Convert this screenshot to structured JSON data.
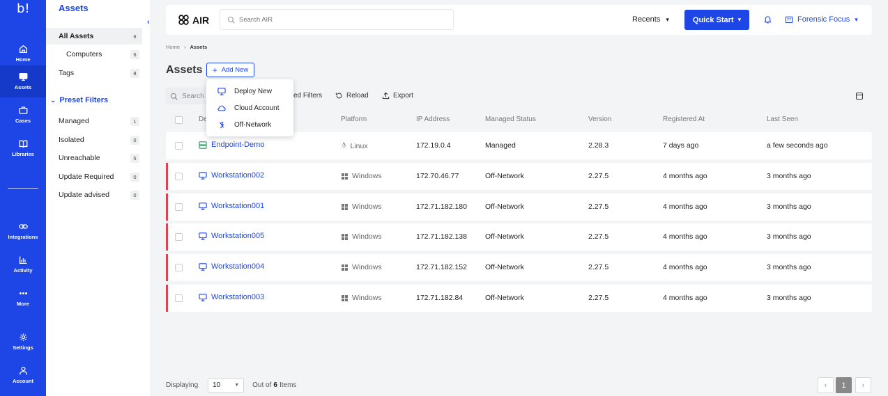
{
  "brand": {
    "logo": "b!",
    "product": "AIR"
  },
  "leftnav": [
    {
      "label": "Home",
      "icon": "home-icon"
    },
    {
      "label": "Assets",
      "icon": "monitor-icon"
    },
    {
      "label": "Cases",
      "icon": "briefcase-icon"
    },
    {
      "label": "Libraries",
      "icon": "book-icon"
    },
    {
      "label": "Integrations",
      "icon": "link-icon"
    },
    {
      "label": "Activity",
      "icon": "chart-icon"
    },
    {
      "label": "More",
      "icon": "dots-icon"
    },
    {
      "label": "Settings",
      "icon": "gear-icon"
    },
    {
      "label": "Account",
      "icon": "user-icon"
    }
  ],
  "sidebar": {
    "title": "Assets",
    "collapse": "‹",
    "items": [
      {
        "label": "All Assets",
        "count": "6"
      },
      {
        "label": "Computers",
        "count": "6"
      },
      {
        "label": "Tags",
        "count": "8"
      }
    ],
    "preset_title": "Preset Filters",
    "presets": [
      {
        "label": "Managed",
        "count": "1"
      },
      {
        "label": "Isolated",
        "count": "0"
      },
      {
        "label": "Unreachable",
        "count": "5"
      },
      {
        "label": "Update Required",
        "count": "0"
      },
      {
        "label": "Update advised",
        "count": "0"
      }
    ]
  },
  "topbar": {
    "search_placeholder": "Search AIR",
    "recents": "Recents",
    "quick_start": "Quick Start",
    "org": "Forensic Focus"
  },
  "breadcrumb": {
    "home": "Home",
    "current": "Assets"
  },
  "page": {
    "title": "Assets",
    "add_new": "Add New"
  },
  "dropdown": [
    {
      "label": "Deploy New",
      "icon": "monitor-icon"
    },
    {
      "label": "Cloud Account",
      "icon": "cloud-icon"
    },
    {
      "label": "Off-Network",
      "icon": "off-network-icon"
    }
  ],
  "toolbar": {
    "search": "Search i",
    "filters": "ed Filters",
    "reload": "Reload",
    "export": "Export"
  },
  "table": {
    "headers": [
      "De",
      "Platform",
      "IP Address",
      "Managed Status",
      "Version",
      "Registered At",
      "Last Seen"
    ],
    "rows": [
      {
        "name": "Endpoint-Demo",
        "platform": "Linux",
        "ip": "172.19.0.4",
        "status": "Managed",
        "version": "2.28.3",
        "registered": "7 days ago",
        "last_seen": "a few seconds ago"
      },
      {
        "name": "Workstation002",
        "platform": "Windows",
        "ip": "172.70.46.77",
        "status": "Off-Network",
        "version": "2.27.5",
        "registered": "4 months ago",
        "last_seen": "3 months ago"
      },
      {
        "name": "Workstation001",
        "platform": "Windows",
        "ip": "172.71.182.180",
        "status": "Off-Network",
        "version": "2.27.5",
        "registered": "4 months ago",
        "last_seen": "3 months ago"
      },
      {
        "name": "Workstation005",
        "platform": "Windows",
        "ip": "172.71.182.138",
        "status": "Off-Network",
        "version": "2.27.5",
        "registered": "4 months ago",
        "last_seen": "3 months ago"
      },
      {
        "name": "Workstation004",
        "platform": "Windows",
        "ip": "172.71.182.152",
        "status": "Off-Network",
        "version": "2.27.5",
        "registered": "4 months ago",
        "last_seen": "3 months ago"
      },
      {
        "name": "Workstation003",
        "platform": "Windows",
        "ip": "172.71.182.84",
        "status": "Off-Network",
        "version": "2.27.5",
        "registered": "4 months ago",
        "last_seen": "3 months ago"
      }
    ]
  },
  "footer": {
    "displaying": "Displaying",
    "page_size": "10",
    "out_of": "Out of",
    "total": "6",
    "items": "Items",
    "page": "1",
    "prev": "‹",
    "next": "›"
  },
  "colors": {
    "accent": "#1e46e6",
    "offline": "#e0434f"
  }
}
